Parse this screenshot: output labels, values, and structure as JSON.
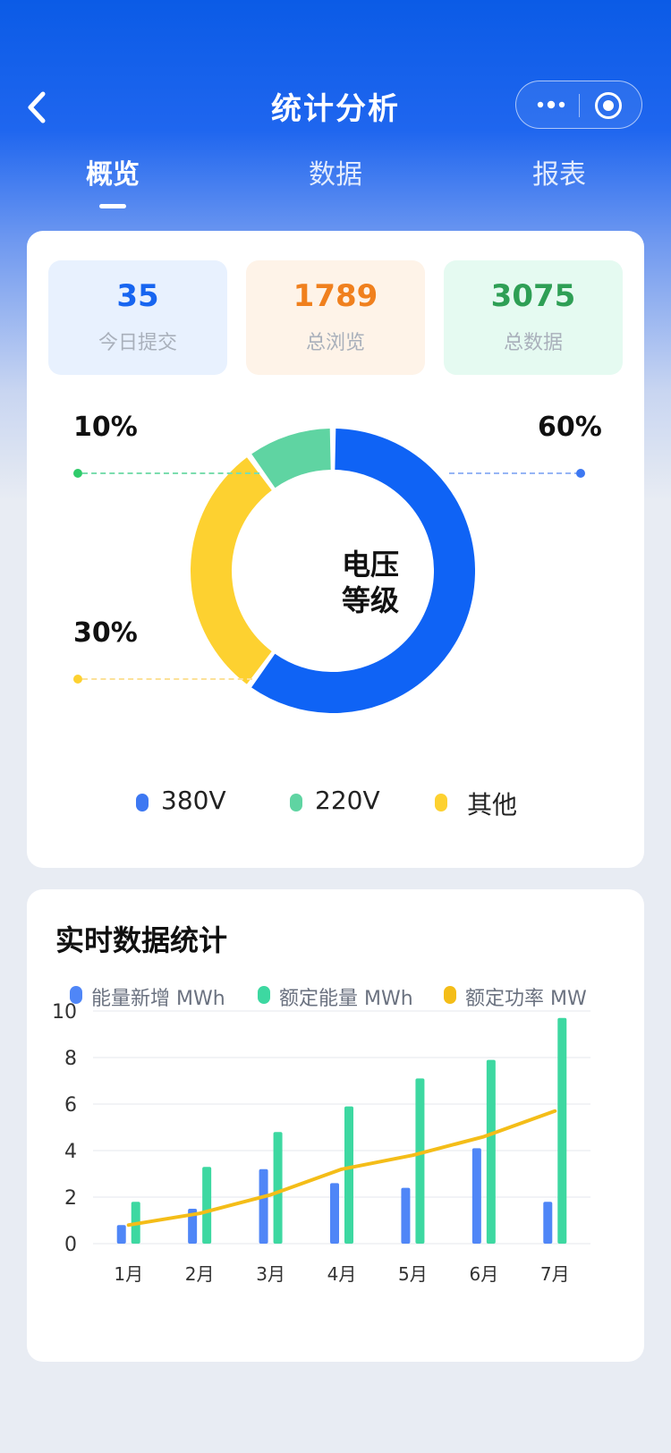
{
  "header": {
    "title": "统计分析"
  },
  "tabs": [
    {
      "label": "概览"
    },
    {
      "label": "数据"
    },
    {
      "label": "报表"
    }
  ],
  "stats": [
    {
      "value": "35",
      "label": "今日提交",
      "color": "#1765F0",
      "bg": "#E8F1FE"
    },
    {
      "value": "1789",
      "label": "总浏览",
      "color": "#F0801E",
      "bg": "#FEF3E8"
    },
    {
      "value": "3075",
      "label": "总数据",
      "color": "#2E9F55",
      "bg": "#E5FAF1"
    }
  ],
  "donut": {
    "center_label_line1": "电压",
    "center_label_line2": "等级",
    "slices": [
      {
        "name": "380V",
        "percent": 60,
        "label": "60%",
        "color": "#0F63F5"
      },
      {
        "name": "220V",
        "percent": 10,
        "label": "10%",
        "color": "#5FD4A2"
      },
      {
        "name": "其他",
        "percent": 30,
        "label": "30%",
        "color": "#FDD130"
      }
    ]
  },
  "realtime": {
    "title": "实时数据统计",
    "legend": [
      {
        "name": "能量新增 MWh",
        "color": "#4F86F7"
      },
      {
        "name": "额定能量 MWh",
        "color": "#3DD8A1"
      },
      {
        "name": "额定功率 MW",
        "color": "#F4BD18"
      }
    ]
  },
  "chart_data": {
    "type": "bar",
    "categories": [
      "1月",
      "2月",
      "3月",
      "4月",
      "5月",
      "6月",
      "7月"
    ],
    "ylim": [
      0,
      10
    ],
    "yticks": [
      "0",
      "2",
      "4",
      "6",
      "8",
      "10"
    ],
    "series": [
      {
        "name": "能量新增 MWh",
        "type": "bar",
        "color": "#4F86F7",
        "values": [
          0.8,
          1.5,
          3.2,
          2.6,
          2.4,
          4.1,
          1.8
        ]
      },
      {
        "name": "额定能量 MWh",
        "type": "bar",
        "color": "#3DD8A1",
        "values": [
          1.8,
          3.3,
          4.8,
          5.9,
          7.1,
          7.9,
          9.7
        ]
      },
      {
        "name": "额定功率 MW",
        "type": "line",
        "color": "#F4BD18",
        "values": [
          0.8,
          1.3,
          2.1,
          3.2,
          3.8,
          4.6,
          5.7
        ]
      }
    ],
    "grid": true,
    "legend_position": "top"
  }
}
